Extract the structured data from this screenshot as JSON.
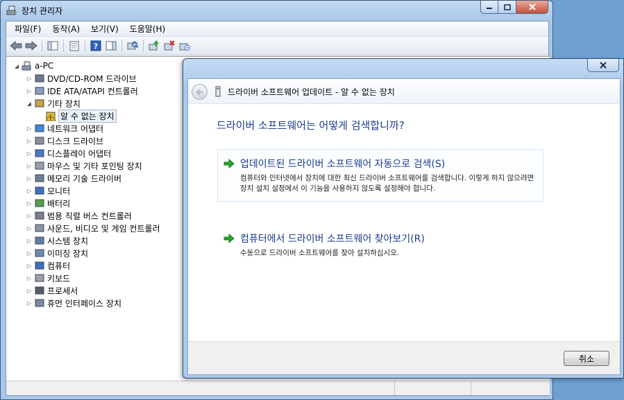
{
  "window": {
    "title": "장치 관리자",
    "menu": [
      "파일(F)",
      "동작(A)",
      "보기(V)",
      "도움말(H)"
    ]
  },
  "tree": {
    "root": "a-PC",
    "items": [
      {
        "label": "DVD/CD-ROM 드라이브",
        "icon": "dvd-drive-icon"
      },
      {
        "label": "IDE ATA/ATAPI 컨트롤러",
        "icon": "ide-controller-icon"
      },
      {
        "label": "기타 장치",
        "icon": "other-devices-icon",
        "expanded": true
      },
      {
        "label": "알 수 없는 장치",
        "icon": "unknown-device-warning-icon",
        "child": true,
        "selected": true
      },
      {
        "label": "네트워크 어댑터",
        "icon": "network-adapter-icon"
      },
      {
        "label": "디스크 드라이브",
        "icon": "disk-drive-icon"
      },
      {
        "label": "디스플레이 어댑터",
        "icon": "display-adapter-icon"
      },
      {
        "label": "마우스 및 기타 포인팅 장치",
        "icon": "mouse-icon"
      },
      {
        "label": "메모리 기술 드라이버",
        "icon": "memory-icon"
      },
      {
        "label": "모니터",
        "icon": "monitor-icon"
      },
      {
        "label": "배터리",
        "icon": "battery-icon"
      },
      {
        "label": "범용 직렬 버스 컨트롤러",
        "icon": "usb-icon"
      },
      {
        "label": "사운드, 비디오 및 게임 컨트롤러",
        "icon": "sound-icon"
      },
      {
        "label": "시스템 장치",
        "icon": "system-device-icon"
      },
      {
        "label": "이미징 장치",
        "icon": "imaging-device-icon"
      },
      {
        "label": "컴퓨터",
        "icon": "computer-icon"
      },
      {
        "label": "키보드",
        "icon": "keyboard-icon"
      },
      {
        "label": "프로세서",
        "icon": "processor-icon"
      },
      {
        "label": "휴먼 인터페이스 장치",
        "icon": "hid-icon"
      }
    ]
  },
  "dialog": {
    "header_title": "드라이버 소프트웨어 업데이트 - 알 수 없는 장치",
    "question": "드라이버 소프트웨어는 어떻게 검색합니까?",
    "option_auto": {
      "title": "업데이트된 드라이버 소프트웨어 자동으로 검색(S)",
      "desc": "컴퓨터와 인터넷에서 장치에 대한 최신 드라이버 소프트웨어를 검색합니다. 이렇게 하지 않으려면 장치 설치 설정에서 이 기능을 사용하지 않도록 설정해야 합니다."
    },
    "option_browse": {
      "title": "컴퓨터에서 드라이버 소프트웨어 찾아보기(R)",
      "desc": "수동으로 드라이버 소프트웨어를 찾아 설치하십시오."
    },
    "cancel_label": "취소"
  },
  "colors": {
    "accent_text": "#1b3d8c",
    "arrow_green": "#2aa52a",
    "titlebar": "#abc9eb"
  }
}
